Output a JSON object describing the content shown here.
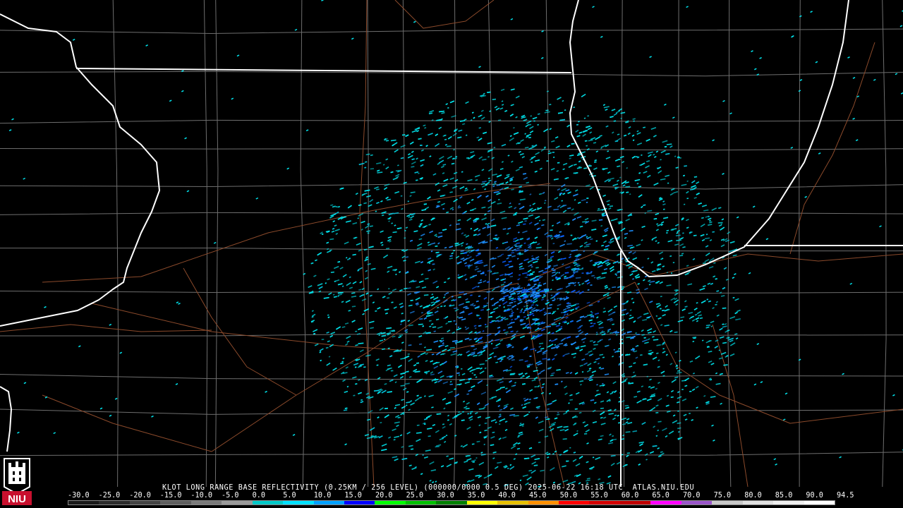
{
  "header": {
    "station": "KLOT",
    "product": "LONG RANGE BASE REFLECTIVITY",
    "resolution": "(0.25KM / 256 LEVEL)",
    "volume": "(000000/0000",
    "tilt": "0.5 DEG)",
    "datetime": "2025-06-22 16:18 UTC",
    "source": "ATLAS.NIU.EDU"
  },
  "scale": {
    "labels": [
      "-30.0",
      "-25.0",
      "-20.0",
      "-15.0",
      "-10.0",
      "-5.0",
      "0.0",
      "5.0",
      "10.0",
      "15.0",
      "20.0",
      "25.0",
      "30.0",
      "35.0",
      "40.0",
      "45.0",
      "50.0",
      "55.0",
      "60.0",
      "65.0",
      "70.0",
      "75.0",
      "80.0",
      "85.0",
      "90.0",
      "94.5"
    ],
    "colors": [
      "#1a1a1a",
      "#2c2c2c",
      "#444444",
      "#5e5e5e",
      "#7a7a7a",
      "#9a9a9a",
      "#00c8c8",
      "#00e0ff",
      "#00a0ff",
      "#0000ff",
      "#00ff00",
      "#00c000",
      "#008000",
      "#ffff00",
      "#e7c000",
      "#ff9000",
      "#ff0000",
      "#d40000",
      "#c00000",
      "#ff00ff",
      "#9955c9",
      "#c8c8c8",
      "#e0e0e0",
      "#f0f0f0",
      "#ffffff"
    ]
  },
  "logo": {
    "text": "NIU",
    "brand_color": "#c8102e"
  },
  "map": {
    "state_border_color": "#ffffff",
    "county_border_color": "#6e6e6e",
    "highway_color": "#8b4a2b",
    "echo_colors": [
      "#00e5ee",
      "#00c8e0",
      "#1e90ff",
      "#0a5cff"
    ],
    "radar_site_icon": "radar-site-icon"
  }
}
